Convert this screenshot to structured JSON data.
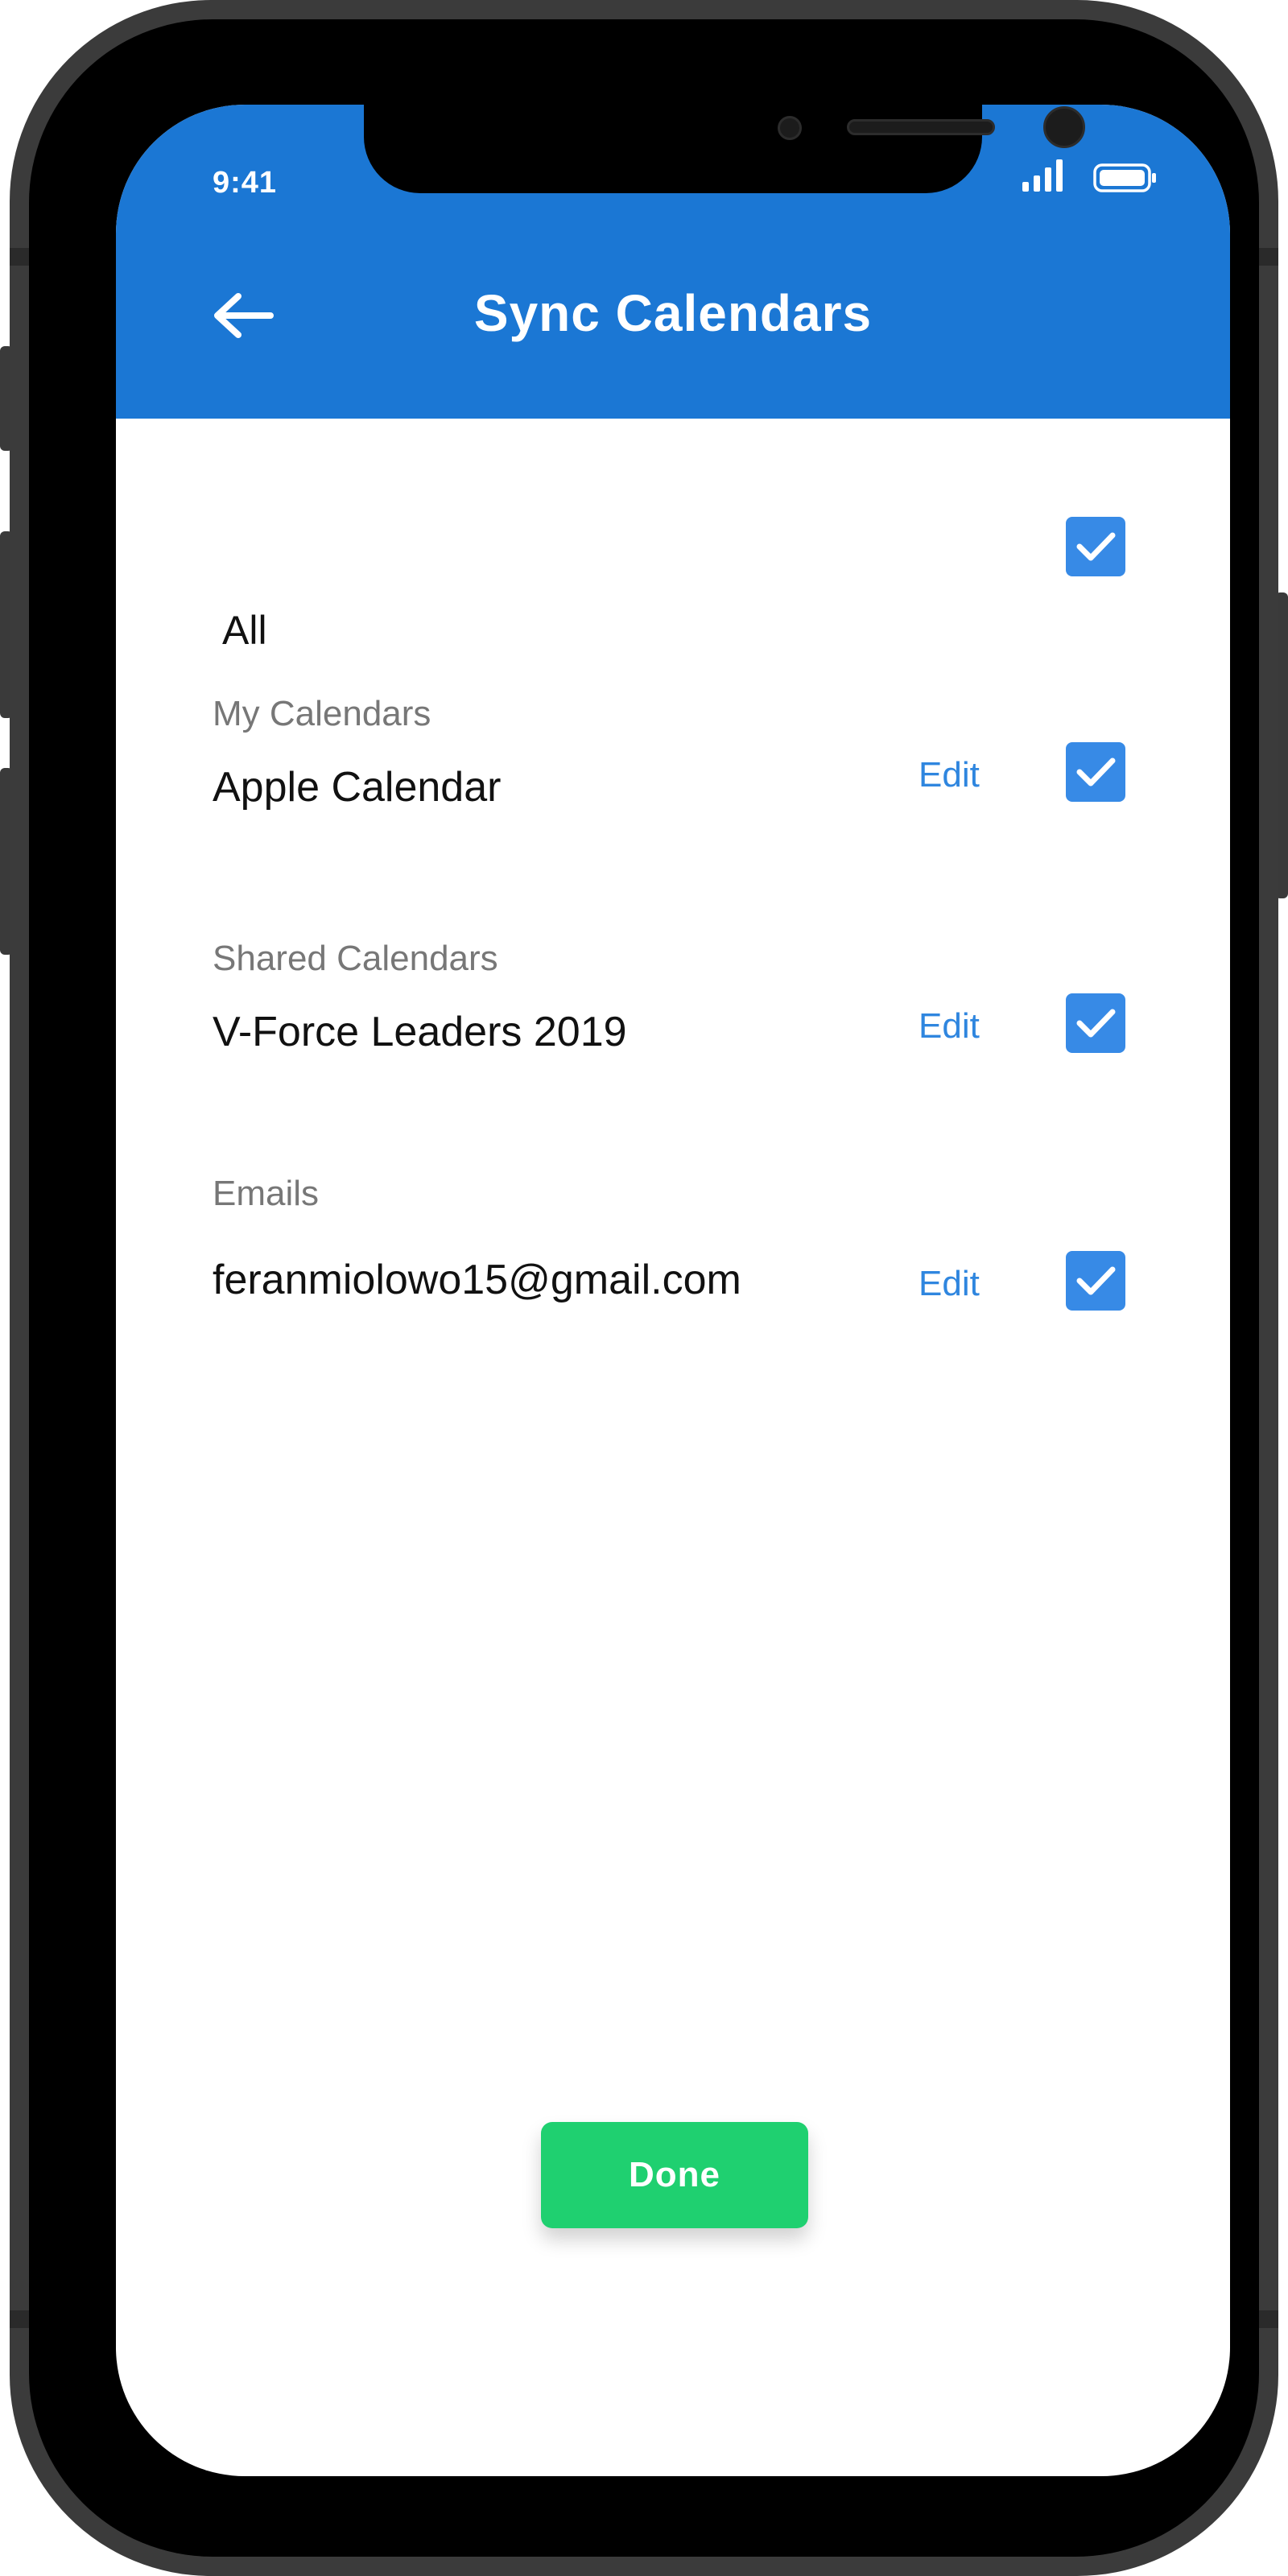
{
  "status_bar": {
    "time": "9:41"
  },
  "header": {
    "title": "Sync Calendars",
    "back_icon": "arrow-left-icon"
  },
  "all_option": {
    "label": "All",
    "checked": true
  },
  "sections": [
    {
      "title": "My Calendars",
      "item": {
        "label": "Apple Calendar",
        "edit_label": "Edit",
        "checked": true
      }
    },
    {
      "title": "Shared Calendars",
      "item": {
        "label": "V-Force Leaders 2019",
        "edit_label": "Edit",
        "checked": true
      }
    },
    {
      "title": "Emails",
      "item": {
        "label": "feranmiolowo15@gmail.com",
        "edit_label": "Edit",
        "checked": true
      }
    }
  ],
  "footer": {
    "done_label": "Done"
  },
  "colors": {
    "header_blue": "#1b77d4",
    "checkbox_blue": "#378ae6",
    "edit_link_blue": "#2f86df",
    "done_green": "#1fd070",
    "section_grey": "#777777"
  }
}
